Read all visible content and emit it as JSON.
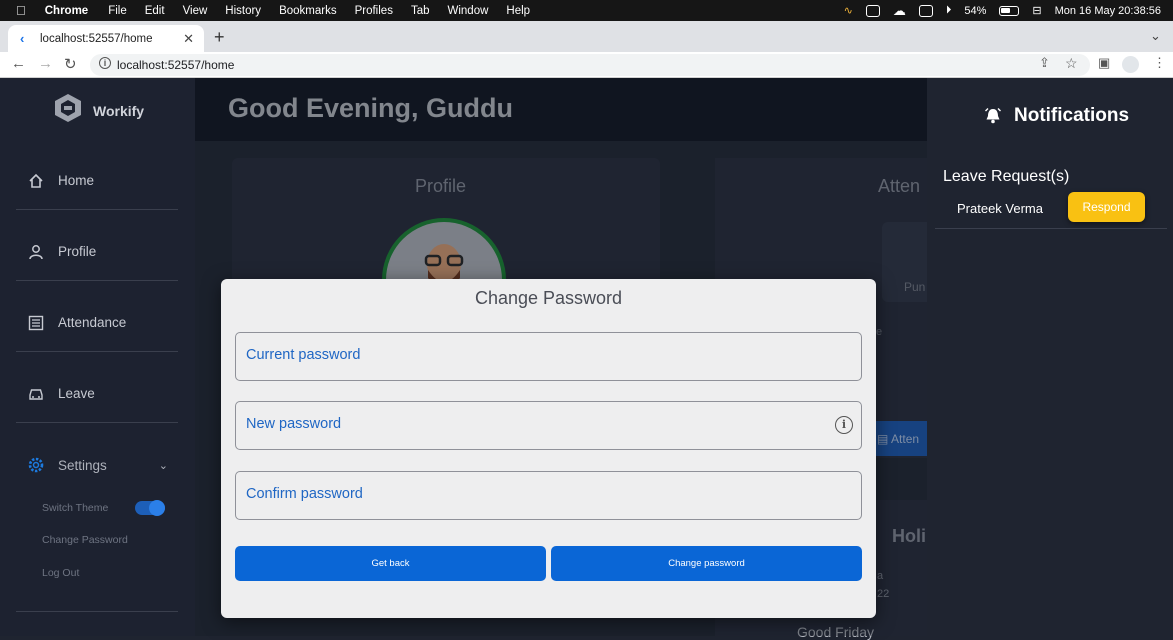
{
  "menubar": {
    "app": "Chrome",
    "items": [
      "File",
      "Edit",
      "View",
      "History",
      "Bookmarks",
      "Profiles",
      "Tab",
      "Window",
      "Help"
    ],
    "battery": "54%",
    "datetime": "Mon 16 May  20:38:56"
  },
  "browser": {
    "tab_title": "localhost:52557/home",
    "url": "localhost:52557/home"
  },
  "sidebar": {
    "brand": "Workify",
    "items": [
      {
        "label": "Home"
      },
      {
        "label": "Profile"
      },
      {
        "label": "Attendance"
      },
      {
        "label": "Leave"
      },
      {
        "label": "Settings"
      }
    ],
    "settings_sub": {
      "switch_theme": "Switch Theme",
      "change_password": "Change Password",
      "logout": "Log Out"
    }
  },
  "header": {
    "greeting": "Good Evening, Guddu"
  },
  "main": {
    "profile_title": "Profile",
    "attendance_title": "Atten",
    "punch_label": "Pun",
    "attendance_btn": "Atten",
    "e_fragment": "e",
    "holidays_title": "Holi",
    "holiday_a": "a",
    "holiday_b": "22",
    "good_friday": "Good Friday"
  },
  "notifications": {
    "title": "Notifications",
    "section": "Leave Request(s)",
    "requests": [
      {
        "name": "Prateek Verma",
        "action": "Respond"
      }
    ],
    "accent": "#f9c112"
  },
  "modal": {
    "title": "Change Password",
    "current_placeholder": "Current password",
    "new_placeholder": "New password",
    "confirm_placeholder": "Confirm password",
    "back_label": "Get back",
    "submit_label": "Change password",
    "button_color": "#0a66d6"
  }
}
